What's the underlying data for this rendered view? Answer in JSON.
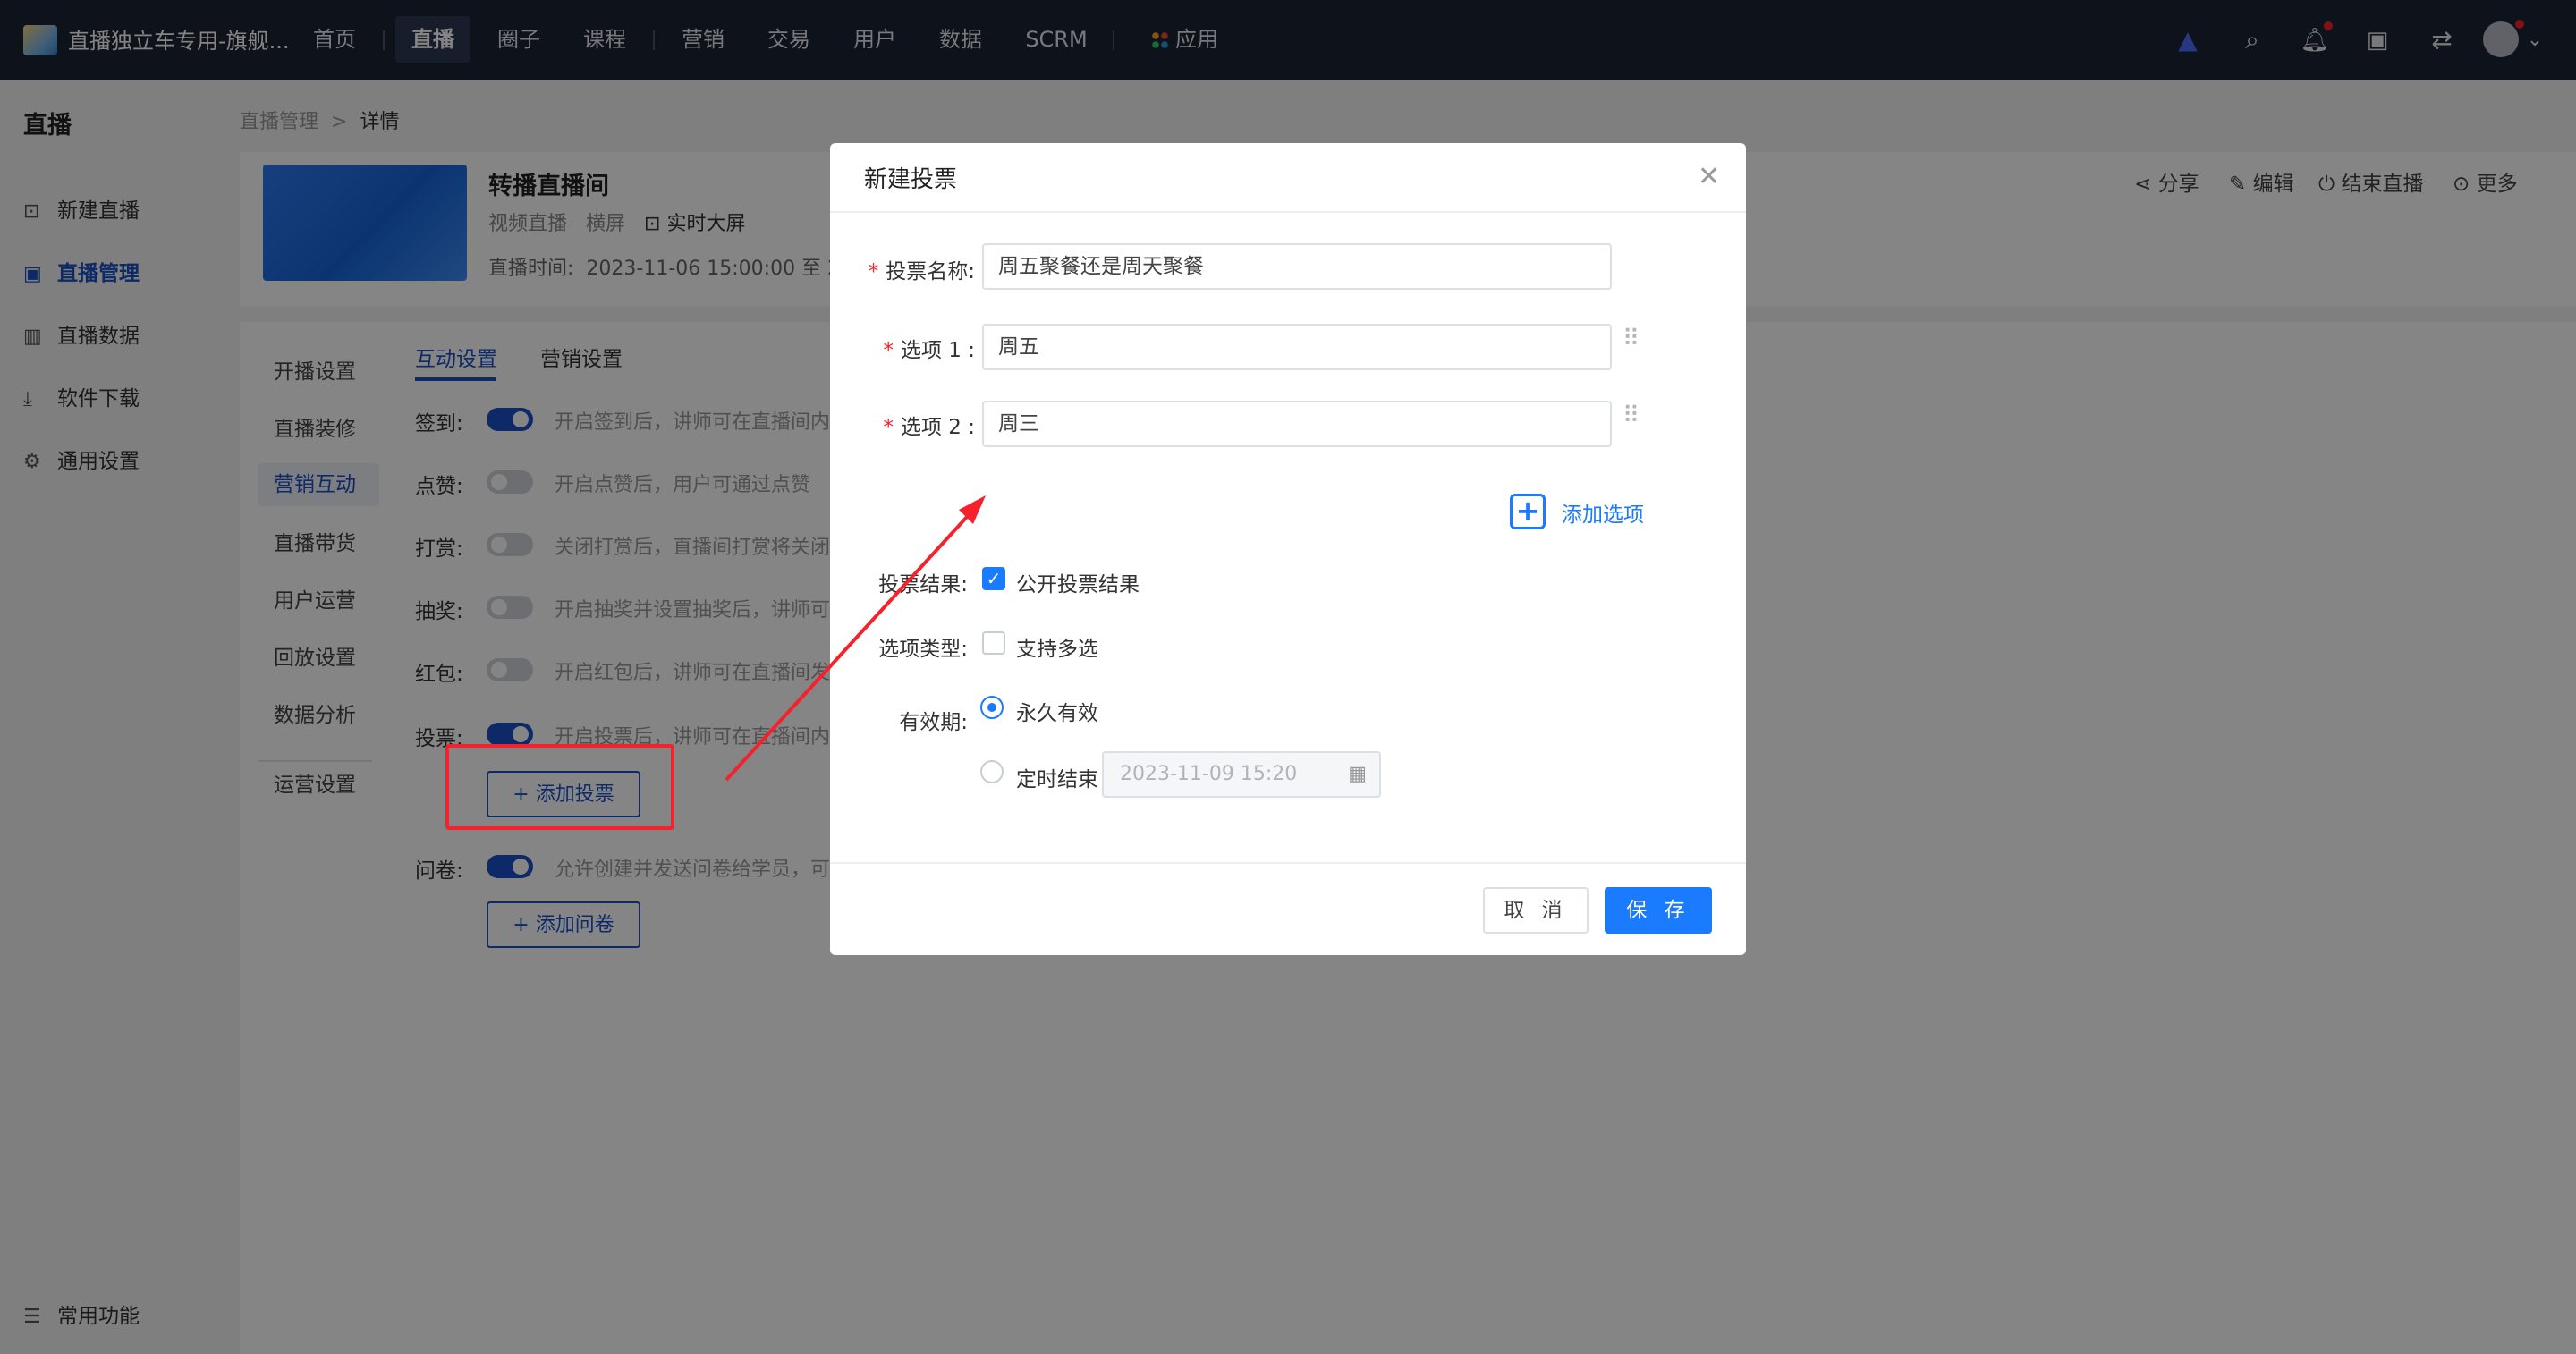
{
  "app": {
    "title": "直播独立车专用-旗舰..."
  },
  "topnav": {
    "items": [
      "首页",
      "直播",
      "圈子",
      "课程",
      "营销",
      "交易",
      "用户",
      "数据",
      "SCRM",
      "应用"
    ],
    "active": "直播"
  },
  "sidebar": {
    "title": "直播",
    "items": [
      "新建直播",
      "直播管理",
      "直播数据",
      "软件下载",
      "通用设置"
    ],
    "bottom": "常用功能"
  },
  "breadcrumb": {
    "parent": "直播管理",
    "separator": ">",
    "current": "详情"
  },
  "live": {
    "name": "转播直播间",
    "type": "视频直播",
    "orientation": "横屏",
    "screen": "实时大屏",
    "time_label": "直播时间:",
    "time_value": "2023-11-06 15:00:00 至 2"
  },
  "header_actions": [
    "分享",
    "编辑",
    "结束直播",
    "更多"
  ],
  "subnav": [
    "开播设置",
    "直播装修",
    "营销互动",
    "直播带货",
    "用户运营",
    "回放设置",
    "数据分析",
    "运营设置"
  ],
  "tabs": [
    "互动设置",
    "营销设置"
  ],
  "settings": [
    {
      "label": "签到:",
      "on": true,
      "desc": "开启签到后，讲师可在直播间内"
    },
    {
      "label": "点赞:",
      "on": false,
      "desc": "开启点赞后，用户可通过点赞"
    },
    {
      "label": "打赏:",
      "on": false,
      "desc": "关闭打赏后，直播间打赏将关闭"
    },
    {
      "label": "抽奖:",
      "on": false,
      "desc": "开启抽奖并设置抽奖后，讲师可"
    },
    {
      "label": "红包:",
      "on": false,
      "desc": "开启红包后，讲师可在直播间发"
    },
    {
      "label": "投票:",
      "on": true,
      "desc": "开启投票后，讲师可在直播间内"
    },
    {
      "label": "问卷:",
      "on": true,
      "desc": "允许创建并发送问卷给学员，可"
    }
  ],
  "buttons": {
    "add_vote": "+ 添加投票",
    "add_survey": "+ 添加问卷"
  },
  "modal": {
    "title": "新建投票",
    "vote_name_label": "投票名称:",
    "vote_name_value": "周五聚餐还是周天聚餐",
    "option1_label": "选项 1 :",
    "option1_value": "周五",
    "option2_label": "选项 2 :",
    "option2_value": "周三",
    "add_option": "添加选项",
    "result_label": "投票结果:",
    "result_option": "公开投票结果",
    "result_checked": true,
    "type_label": "选项类型:",
    "type_option": "支持多选",
    "type_checked": false,
    "validity_label": "有效期:",
    "validity_forever": "永久有效",
    "validity_timed": "定时结束",
    "validity_selected": "永久有效",
    "date_placeholder": "2023-11-09 15:20",
    "cancel": "取 消",
    "save": "保 存"
  },
  "colors": {
    "primary": "#1a7bff",
    "brand": "#1a4fc5",
    "annotation": "#f5222d",
    "nav_bg": "#1c2333"
  }
}
